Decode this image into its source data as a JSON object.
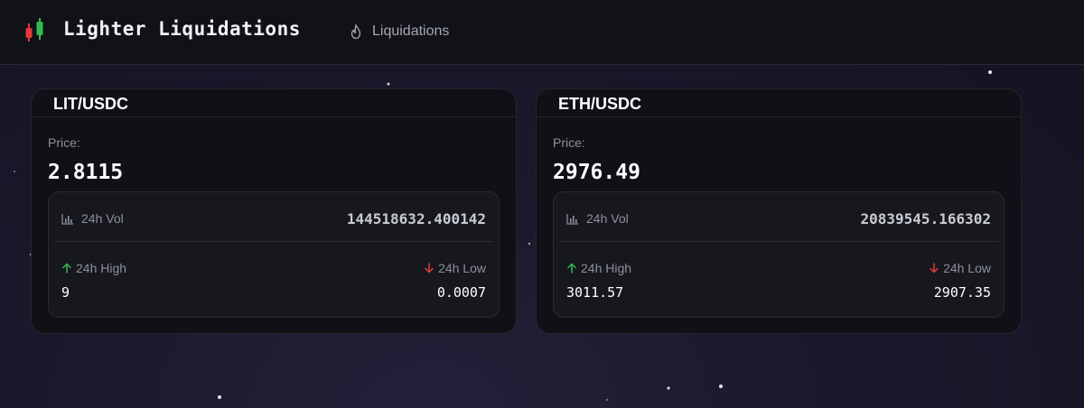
{
  "app": {
    "title": "Lighter Liquidations",
    "logo_icon": "candlestick-icon",
    "nav": {
      "label": "Liquidations",
      "icon": "flame-icon"
    }
  },
  "colors": {
    "up": "#2fbd4f",
    "down": "#e23b3b",
    "background": "#1a182b",
    "card": "#101016"
  },
  "cards": [
    {
      "pair": "LIT/USDC",
      "price_label": "Price:",
      "price": "2.8115",
      "vol_label": "24h Vol",
      "vol_value": "144518632.400142",
      "high_label": "24h High",
      "high_value": "9",
      "low_label": "24h Low",
      "low_value": "0.0007"
    },
    {
      "pair": "ETH/USDC",
      "price_label": "Price:",
      "price": "2976.49",
      "vol_label": "24h Vol",
      "vol_value": "20839545.166302",
      "high_label": "24h High",
      "high_value": "3011.57",
      "low_label": "24h Low",
      "low_value": "2907.35"
    }
  ]
}
